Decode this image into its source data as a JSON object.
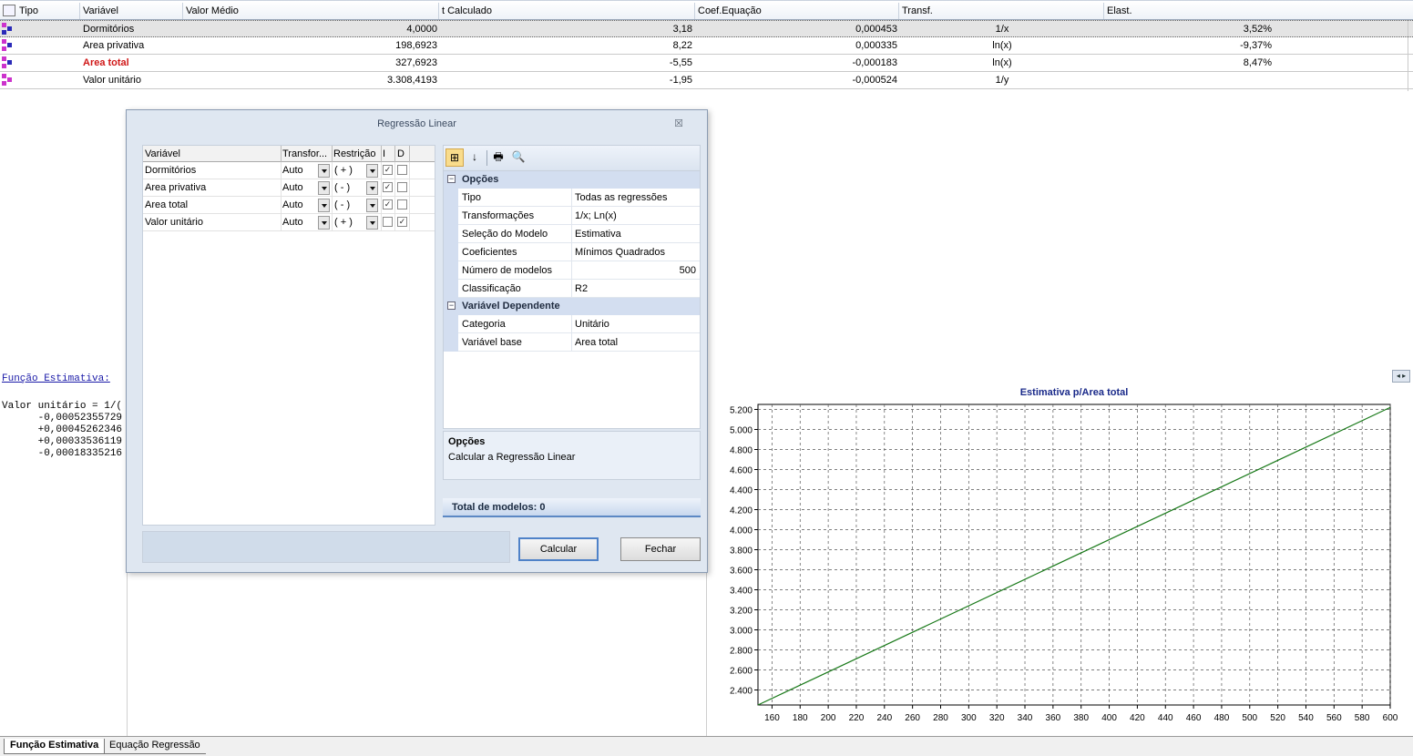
{
  "top_grid": {
    "headers": [
      "Tipo",
      "Variável",
      "Valor Médio",
      "t Calculado",
      "Coef.Equação",
      "Transf.",
      "Elast."
    ],
    "rows": [
      {
        "variavel": "Dormitórios",
        "valor_medio": "4,0000",
        "t_calculado": "3,18",
        "coef": "0,000453",
        "transf": "1/x",
        "elast": "3,52%",
        "highlight": false
      },
      {
        "variavel": "Area privativa",
        "valor_medio": "198,6923",
        "t_calculado": "8,22",
        "coef": "0,000335",
        "transf": "ln(x)",
        "elast": "-9,37%",
        "highlight": false
      },
      {
        "variavel": "Area total",
        "valor_medio": "327,6923",
        "t_calculado": "-5,55",
        "coef": "-0,000183",
        "transf": "ln(x)",
        "elast": "8,47%",
        "highlight": true
      },
      {
        "variavel": "Valor unitário",
        "valor_medio": "3.308,4193",
        "t_calculado": "-1,95",
        "coef": "-0,000524",
        "transf": "1/y",
        "elast": "",
        "highlight": false
      }
    ]
  },
  "function_pane": {
    "title": "Função Estimativa:",
    "lines": [
      "Valor unitário = 1/(",
      "      -0,00052355729",
      "      +0,00045262346",
      "      +0,00033536119",
      "      -0,00018335216"
    ]
  },
  "dialog": {
    "title": "Regressão Linear",
    "close_glyph": "☒",
    "var_grid": {
      "headers": [
        "Variável",
        "Transfor...",
        "Restrição",
        "I",
        "D"
      ],
      "rows": [
        {
          "name": "Dormitórios",
          "transf": "Auto",
          "restr": "( + )",
          "i": "✓",
          "d": ""
        },
        {
          "name": "Area privativa",
          "transf": "Auto",
          "restr": "( - )",
          "i": "✓",
          "d": ""
        },
        {
          "name": "Area total",
          "transf": "Auto",
          "restr": "( - )",
          "i": "✓",
          "d": ""
        },
        {
          "name": "Valor unitário",
          "transf": "Auto",
          "restr": "( + )",
          "i": "",
          "d": "✓"
        }
      ]
    },
    "properties": {
      "categories": [
        {
          "name": "Opções",
          "toggle": "−",
          "rows": [
            {
              "name": "Tipo",
              "value": "Todas as regressões"
            },
            {
              "name": "Transformações",
              "value": "1/x; Ln(x)"
            },
            {
              "name": "Seleção do Modelo",
              "value": "Estimativa"
            },
            {
              "name": "Coeficientes",
              "value": "Mínimos Quadrados"
            },
            {
              "name": "Número de modelos",
              "value": "500",
              "numeric": true
            },
            {
              "name": "Classificação",
              "value": "R2"
            }
          ]
        },
        {
          "name": "Variável Dependente",
          "toggle": "−",
          "rows": [
            {
              "name": "Categoria",
              "value": "Unitário"
            },
            {
              "name": "Variável base",
              "value": "Area total"
            }
          ]
        }
      ],
      "description_title": "Opções",
      "description_text": "Calcular a Regressão Linear",
      "total_label": "Total de modelos: 0"
    },
    "buttons": {
      "calc": "Calcular",
      "close": "Fechar"
    }
  },
  "toolbar_icons": {
    "categorized": "⊞",
    "alpha": "↓",
    "print": "🖶",
    "preview": "🔍"
  },
  "chart_toggle": "◂ ▸",
  "chart_data": {
    "type": "line",
    "title": "Estimativa p/Area total",
    "xlabel": "",
    "ylabel": "",
    "x": [
      150,
      600
    ],
    "series": [
      {
        "values": [
          2250,
          5220
        ]
      }
    ],
    "xlim": [
      150,
      600
    ],
    "ylim": [
      2250,
      5250
    ],
    "x_ticks": [
      "160",
      "180",
      "200",
      "220",
      "240",
      "260",
      "280",
      "300",
      "320",
      "340",
      "360",
      "380",
      "400",
      "420",
      "440",
      "460",
      "480",
      "500",
      "520",
      "540",
      "560",
      "580",
      "600"
    ],
    "y_ticks": [
      "2.400",
      "2.600",
      "2.800",
      "3.000",
      "3.200",
      "3.400",
      "3.600",
      "3.800",
      "4.000",
      "4.200",
      "4.400",
      "4.600",
      "4.800",
      "5.000",
      "5.200"
    ],
    "grid": true,
    "line_color": "#1a7a1a",
    "title_color": "#1a2a8a"
  },
  "bottom_tabs": [
    "Função Estimativa",
    "Equação Regressão"
  ],
  "colors": {
    "highlight_red": "#d01818",
    "accent_blue": "#4f82c8"
  }
}
